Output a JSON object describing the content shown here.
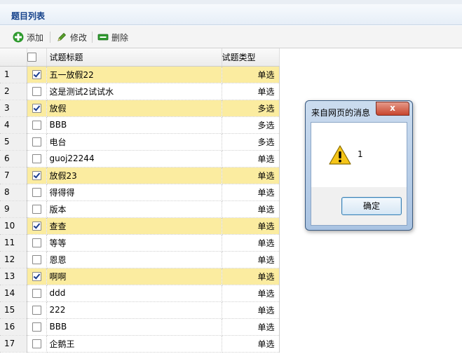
{
  "panel": {
    "title": "题目列表"
  },
  "toolbar": {
    "add_label": "添加",
    "edit_label": "修改",
    "delete_label": "删除"
  },
  "grid": {
    "columns": {
      "title": "试题标题",
      "type": "试题类型"
    },
    "rows": [
      {
        "num": "1",
        "checked": true,
        "title": "五一放假22",
        "type": "单选"
      },
      {
        "num": "2",
        "checked": false,
        "title": "这是测试2试试水",
        "type": "单选"
      },
      {
        "num": "3",
        "checked": true,
        "title": "放假",
        "type": "多选"
      },
      {
        "num": "4",
        "checked": false,
        "title": "BBB",
        "type": "多选"
      },
      {
        "num": "5",
        "checked": false,
        "title": "电台",
        "type": "多选"
      },
      {
        "num": "6",
        "checked": false,
        "title": "guoj22244",
        "type": "单选"
      },
      {
        "num": "7",
        "checked": true,
        "title": "放假23",
        "type": "单选"
      },
      {
        "num": "8",
        "checked": false,
        "title": "得得得",
        "type": "单选"
      },
      {
        "num": "9",
        "checked": false,
        "title": "版本",
        "type": "单选"
      },
      {
        "num": "10",
        "checked": true,
        "title": "查查",
        "type": "单选"
      },
      {
        "num": "11",
        "checked": false,
        "title": "等等",
        "type": "单选"
      },
      {
        "num": "12",
        "checked": false,
        "title": "恩恩",
        "type": "单选"
      },
      {
        "num": "13",
        "checked": true,
        "title": "啊啊",
        "type": "单选"
      },
      {
        "num": "14",
        "checked": false,
        "title": "ddd",
        "type": "单选"
      },
      {
        "num": "15",
        "checked": false,
        "title": "222",
        "type": "单选"
      },
      {
        "num": "16",
        "checked": false,
        "title": "BBB",
        "type": "单选"
      },
      {
        "num": "17",
        "checked": false,
        "title": "企鹅王",
        "type": "单选"
      }
    ]
  },
  "dialog": {
    "title": "来自网页的消息",
    "close_label": "x",
    "message": "1",
    "ok_label": "确定"
  },
  "colors": {
    "selected_row": "#fbeca0",
    "title_text": "#15428b"
  }
}
